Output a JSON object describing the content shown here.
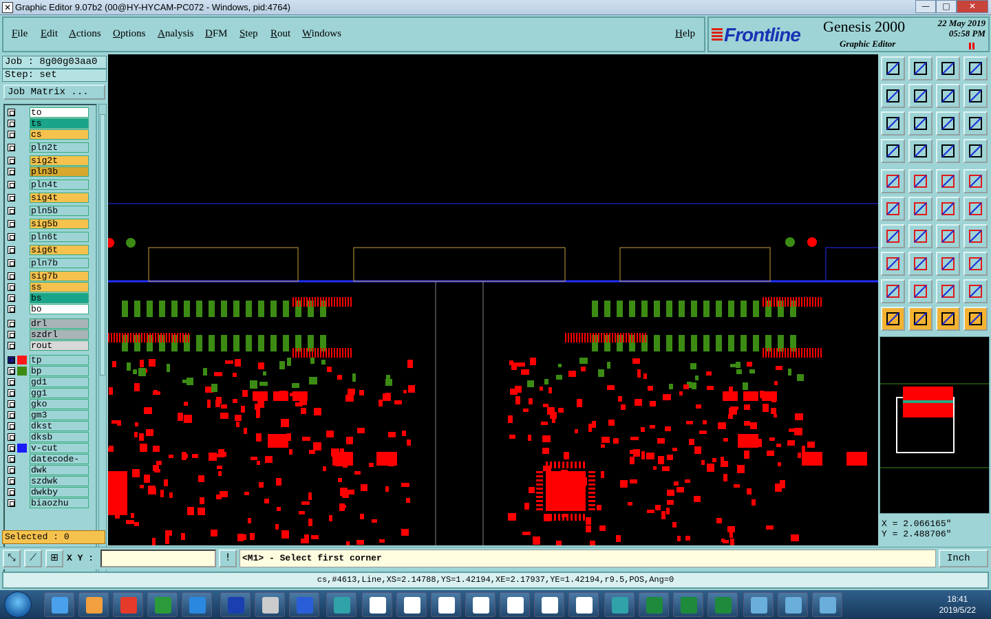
{
  "window": {
    "title": "Graphic Editor 9.07b2 (00@HY-HYCAM-PC072 - Windows, pid:4764)",
    "minimize": "—",
    "maximize": "□",
    "close": "✕"
  },
  "menu": {
    "items": [
      "File",
      "Edit",
      "Actions",
      "Options",
      "Analysis",
      "DFM",
      "Step",
      "Rout",
      "Windows"
    ],
    "help": "Help"
  },
  "brand": {
    "logo": "Frontline",
    "product": "Genesis 2000",
    "subtitle": "Graphic Editor",
    "date": "22 May 2019",
    "time": "05:58 PM"
  },
  "job": {
    "job_label": "Job : 8g00g03aa0",
    "step_label": "Step: set",
    "matrix_button": "Job Matrix ..."
  },
  "layers": [
    {
      "name": "to",
      "color": "#ffffff"
    },
    {
      "name": "ts",
      "color": "#1aa58a"
    },
    {
      "name": "cs",
      "color": "#f6c24e"
    },
    {
      "name": "pln2t",
      "color": "#9ed4d6"
    },
    {
      "name": "sig2t",
      "color": "#f6c24e"
    },
    {
      "name": "pln3b",
      "color": "#d7a830"
    },
    {
      "name": "pln4t",
      "color": "#9ed4d6"
    },
    {
      "name": "sig4t",
      "color": "#f6c24e"
    },
    {
      "name": "pln5b",
      "color": "#9ed4d6"
    },
    {
      "name": "sig5b",
      "color": "#f6c24e"
    },
    {
      "name": "pln6t",
      "color": "#9ed4d6"
    },
    {
      "name": "sig6t",
      "color": "#f6c24e"
    },
    {
      "name": "pln7b",
      "color": "#9ed4d6"
    },
    {
      "name": "sig7b",
      "color": "#f6c24e"
    },
    {
      "name": "ss",
      "color": "#f6c24e"
    },
    {
      "name": "bs",
      "color": "#1aa58a"
    },
    {
      "name": "bo",
      "color": "#ffffff"
    },
    {
      "name": "drl",
      "color": "#a8b4b8"
    },
    {
      "name": "szdrl",
      "color": "#a8b4b8"
    },
    {
      "name": "rout",
      "color": "#d8d8d8"
    },
    {
      "name": "tp",
      "color": "#9ed4d6",
      "swatch": "#ff1a1a",
      "active": true
    },
    {
      "name": "bp",
      "color": "#9ed4d6",
      "swatch": "#3c8c14"
    },
    {
      "name": "gd1",
      "color": "#9ed4d6"
    },
    {
      "name": "gg1",
      "color": "#9ed4d6"
    },
    {
      "name": "gko",
      "color": "#9ed4d6"
    },
    {
      "name": "gm3",
      "color": "#9ed4d6"
    },
    {
      "name": "dkst",
      "color": "#9ed4d6"
    },
    {
      "name": "dksb",
      "color": "#9ed4d6"
    },
    {
      "name": "v-cut",
      "color": "#9ed4d6",
      "swatch": "#1a1aff"
    },
    {
      "name": "datecode-pt",
      "color": "#9ed4d6"
    },
    {
      "name": "dwk",
      "color": "#9ed4d6"
    },
    {
      "name": "szdwk",
      "color": "#9ed4d6"
    },
    {
      "name": "dwkby",
      "color": "#9ed4d6"
    },
    {
      "name": "biaozhu",
      "color": "#9ed4d6"
    }
  ],
  "selected": "Selected : 0",
  "coords": {
    "x": "X = 2.066165\"",
    "y": "Y = 2.488706\""
  },
  "bottom": {
    "xy_label": "X Y :",
    "xy_value": "",
    "message": "<M1> - Select first corner",
    "unit": "Inch"
  },
  "status": "cs,#4613,Line,XS=2.14788,YS=1.42194,XE=2.17937,YE=1.42194,r9.5,POS,Ang=0",
  "taskbar": {
    "time": "18:41",
    "date": "2019/5/22"
  },
  "colors": {
    "pad": "#ff0000",
    "green": "#3c8c14",
    "outline": "#c8a040",
    "vcut": "#2030ff",
    "panel": "#9ed4d6"
  }
}
